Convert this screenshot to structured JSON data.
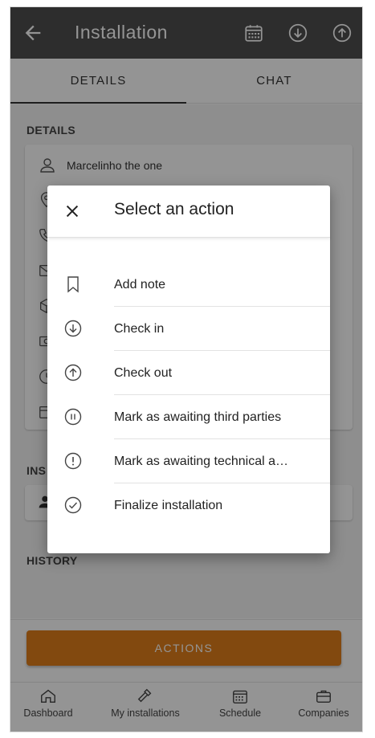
{
  "appbar": {
    "title": "Installation",
    "icons": [
      "back-arrow-icon",
      "calendar-icon",
      "check-in-icon",
      "check-out-icon"
    ]
  },
  "tabs": [
    {
      "label": "DETAILS",
      "active": true
    },
    {
      "label": "CHAT",
      "active": false
    }
  ],
  "details": {
    "section_title": "DETAILS",
    "client_name": "Marcelinho the one",
    "row_icons": [
      "person-icon",
      "location-icon",
      "phone-icon",
      "mail-icon",
      "box-icon",
      "money-icon",
      "clock-icon",
      "calendar-icon"
    ]
  },
  "installer": {
    "section_title_partial": "INS"
  },
  "history": {
    "section_title_partial_visible": "HIS",
    "section_title_obscured": "TORY"
  },
  "actions_button": "ACTIONS",
  "bottom_nav": [
    {
      "label": "Dashboard",
      "icon": "home-icon"
    },
    {
      "label": "My installations",
      "icon": "hammer-icon"
    },
    {
      "label": "Schedule",
      "icon": "calendar-icon"
    },
    {
      "label": "Companies",
      "icon": "briefcase-icon"
    }
  ],
  "dialog": {
    "title": "Select an action",
    "close_icon": "close-icon",
    "items": [
      {
        "label": "Add note",
        "icon": "bookmark-icon"
      },
      {
        "label": "Check in",
        "icon": "arrow-down-circle-icon"
      },
      {
        "label": "Check out",
        "icon": "arrow-up-circle-icon"
      },
      {
        "label": "Mark as awaiting third parties",
        "icon": "pause-circle-icon"
      },
      {
        "label": "Mark as awaiting technical a…",
        "icon": "alert-circle-icon"
      },
      {
        "label": "Finalize installation",
        "icon": "check-circle-icon"
      }
    ]
  },
  "colors": {
    "appbar": "#4f4f4f",
    "accent": "#e07f1a",
    "scrim": "rgba(0,0,0,0.42)"
  }
}
